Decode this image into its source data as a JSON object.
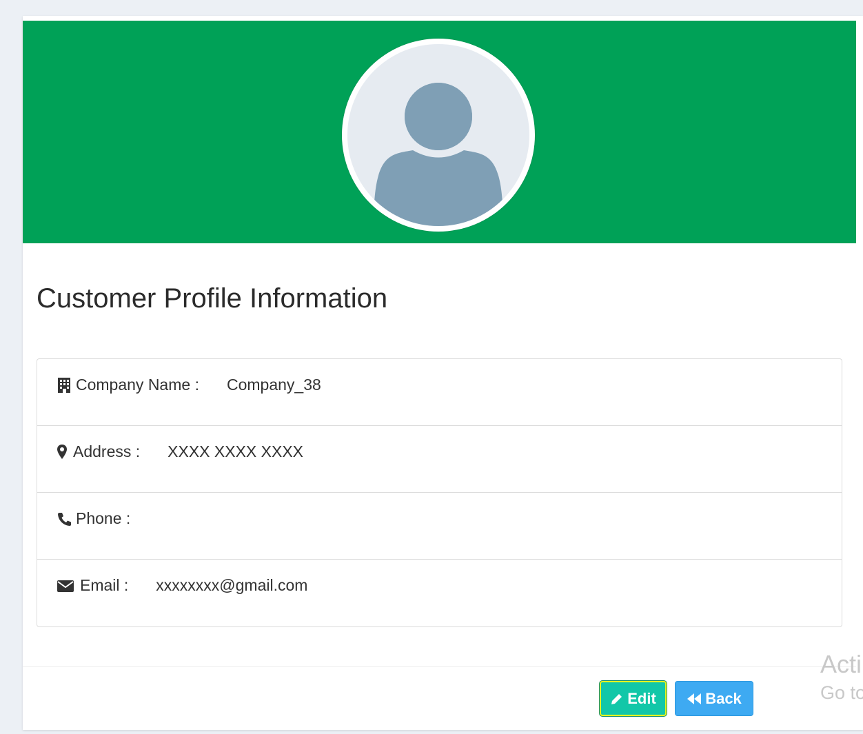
{
  "page": {
    "title": "Customer Profile Information"
  },
  "colors": {
    "banner": "#00a157",
    "avatar_silhouette": "#7f9fb5",
    "avatar_bg": "#e6ebf1",
    "edit_button": "#12c7a8",
    "back_button": "#3eaaf2"
  },
  "avatar": {
    "icon": "user-silhouette-icon"
  },
  "profile": {
    "rows": [
      {
        "icon": "building-icon",
        "label": "Company Name :",
        "value": "Company_38"
      },
      {
        "icon": "map-marker-icon",
        "label": "Address :",
        "value": "XXXX XXXX XXXX"
      },
      {
        "icon": "phone-icon",
        "label": "Phone :",
        "value": ""
      },
      {
        "icon": "envelope-icon",
        "label": "Email :",
        "value": "xxxxxxxx@gmail.com"
      }
    ]
  },
  "actions": {
    "edit_label": "Edit",
    "back_label": "Back"
  },
  "watermark": {
    "line1": "Acti",
    "line2": "Go to"
  }
}
